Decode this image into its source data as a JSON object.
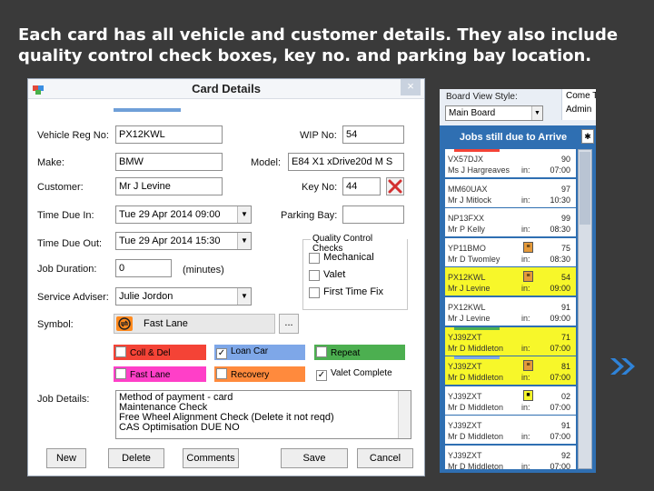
{
  "heading": {
    "line1": "Each card has all vehicle and customer details. They also include",
    "line2": "quality control check boxes, key no. and parking bay location."
  },
  "dialog": {
    "title": "Card Details",
    "close_label": "×",
    "labels": {
      "vehicle_reg": "Vehicle Reg No:",
      "wip": "WIP No:",
      "make": "Make:",
      "model": "Model:",
      "customer": "Customer:",
      "key_no": "Key No:",
      "time_in": "Time Due In:",
      "parking_bay": "Parking Bay:",
      "time_out": "Time Due Out:",
      "job_duration": "Job Duration:",
      "minutes": "(minutes)",
      "service_adviser": "Service Adviser:",
      "symbol": "Symbol:",
      "job_details": "Job Details:"
    },
    "values": {
      "vehicle_reg": "PX12KWL",
      "wip": "54",
      "make": "BMW",
      "model": "E84 X1 xDrive20d M S",
      "customer": "Mr J Levine",
      "key_no": "44",
      "time_in": "Tue 29 Apr 2014 09:00",
      "parking_bay": "",
      "time_out": "Tue 29 Apr 2014 15:30",
      "job_duration": "0",
      "service_adviser": "Julie Jordon",
      "symbol": "Fast Lane"
    },
    "quality_checks": {
      "title": "Quality Control Checks",
      "items": [
        {
          "label": "Mechanical",
          "checked": false
        },
        {
          "label": "Valet",
          "checked": false
        },
        {
          "label": "First Time Fix",
          "checked": false
        }
      ]
    },
    "categories": [
      {
        "label": "Coll & Del",
        "color": "#f44336",
        "checked": false
      },
      {
        "label": "Loan Car",
        "color": "#7ea7e8",
        "checked": true
      },
      {
        "label": "Repeat",
        "color": "#4caf50",
        "checked": false
      },
      {
        "label": "Fast Lane",
        "color": "#ff3fc8",
        "checked": false
      },
      {
        "label": "Recovery",
        "color": "#ff8a3d",
        "checked": false
      },
      {
        "label": "Valet Complete",
        "color": "#ffffff",
        "checked": true
      }
    ],
    "job_details_lines": [
      "Method of payment - card",
      "Maintenance Check",
      "Free Wheel Alignment Check (Delete it not reqd)",
      "CAS Optimisation DUE NO"
    ],
    "buttons": {
      "new": "New",
      "delete": "Delete",
      "comments": "Comments",
      "save": "Save",
      "cancel": "Cancel"
    }
  },
  "board": {
    "view_label": "Board View Style:",
    "view_value": "Main Board",
    "right_items": [
      "Come Ti",
      "Admin"
    ],
    "panel_title": "Jobs still due to Arrive",
    "cards": [
      {
        "reg": "VX57DJX",
        "customer": "Ms J Hargreaves",
        "wip": "90",
        "time": "07:00",
        "yellow": false,
        "strip": "#f44336",
        "icon": ""
      },
      {
        "reg": "MM60UAX",
        "customer": "Mr J Mitlock",
        "wip": "97",
        "time": "10:30",
        "yellow": false,
        "strip": "",
        "icon": ""
      },
      {
        "reg": "NP13FXX",
        "customer": "Mr P Kelly",
        "wip": "99",
        "time": "08:30",
        "yellow": false,
        "strip": "",
        "icon": ""
      },
      {
        "reg": "YP11BMO",
        "customer": "Mr D Twomley",
        "wip": "75",
        "time": "08:30",
        "yellow": false,
        "strip": "",
        "icon": "≡"
      },
      {
        "reg": "PX12KWL",
        "customer": "Mr J Levine",
        "wip": "54",
        "time": "09:00",
        "yellow": true,
        "strip": "",
        "icon": "≡"
      },
      {
        "reg": "PX12KWL",
        "customer": "Mr J Levine",
        "wip": "91",
        "time": "09:00",
        "yellow": false,
        "strip": "",
        "icon": ""
      },
      {
        "reg": "YJ39ZXT",
        "customer": "Mr D Middleton",
        "wip": "71",
        "time": "07:00",
        "yellow": true,
        "strip": "#4caf50",
        "icon": ""
      },
      {
        "reg": "YJ39ZXT",
        "customer": "Mr D Middleton",
        "wip": "81",
        "time": "07:00",
        "yellow": true,
        "strip": "#7ea7e8",
        "icon": "≡"
      },
      {
        "reg": "YJ39ZXT",
        "customer": "Mr D Middleton",
        "wip": "02",
        "time": "07:00",
        "yellow": false,
        "strip": "",
        "icon": "■"
      },
      {
        "reg": "YJ39ZXT",
        "customer": "Mr D Middleton",
        "wip": "91",
        "time": "07:00",
        "yellow": false,
        "strip": "",
        "icon": ""
      },
      {
        "reg": "YJ39ZXT",
        "customer": "Mr D Middleton",
        "wip": "92",
        "time": "07:00",
        "yellow": false,
        "strip": "",
        "icon": ""
      }
    ],
    "card_label": "in:",
    "pin_label": "✱"
  },
  "colors": {
    "background": "#3a3a3a",
    "panel_blue": "#2f6fb2",
    "accent_blue": "#6f9fd8",
    "arrow_blue": "#2f83d8"
  }
}
